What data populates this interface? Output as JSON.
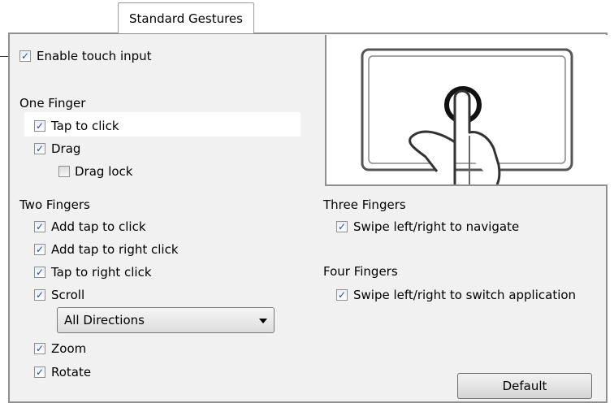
{
  "tab": {
    "label": "Standard Gestures"
  },
  "enable_touch": {
    "label": "Enable touch input",
    "checked": true
  },
  "one_finger": {
    "header": "One Finger",
    "tap_to_click": "Tap to click",
    "drag": "Drag",
    "drag_lock": "Drag lock"
  },
  "two_fingers": {
    "header": "Two Fingers",
    "add_tap_to_click": "Add tap to click",
    "add_tap_to_right_click": "Add tap to right click",
    "tap_to_right_click": "Tap to right click",
    "scroll": "Scroll",
    "scroll_direction": "All Directions",
    "zoom": "Zoom",
    "rotate": "Rotate"
  },
  "three_fingers": {
    "header": "Three Fingers",
    "swipe": "Swipe left/right to navigate"
  },
  "four_fingers": {
    "header": "Four Fingers",
    "swipe": "Swipe left/right to switch application"
  },
  "default_button": "Default",
  "checkmark": "✓",
  "icons": [
    "touchpad-tap-illustration-icon",
    "dropdown-arrow-icon"
  ]
}
